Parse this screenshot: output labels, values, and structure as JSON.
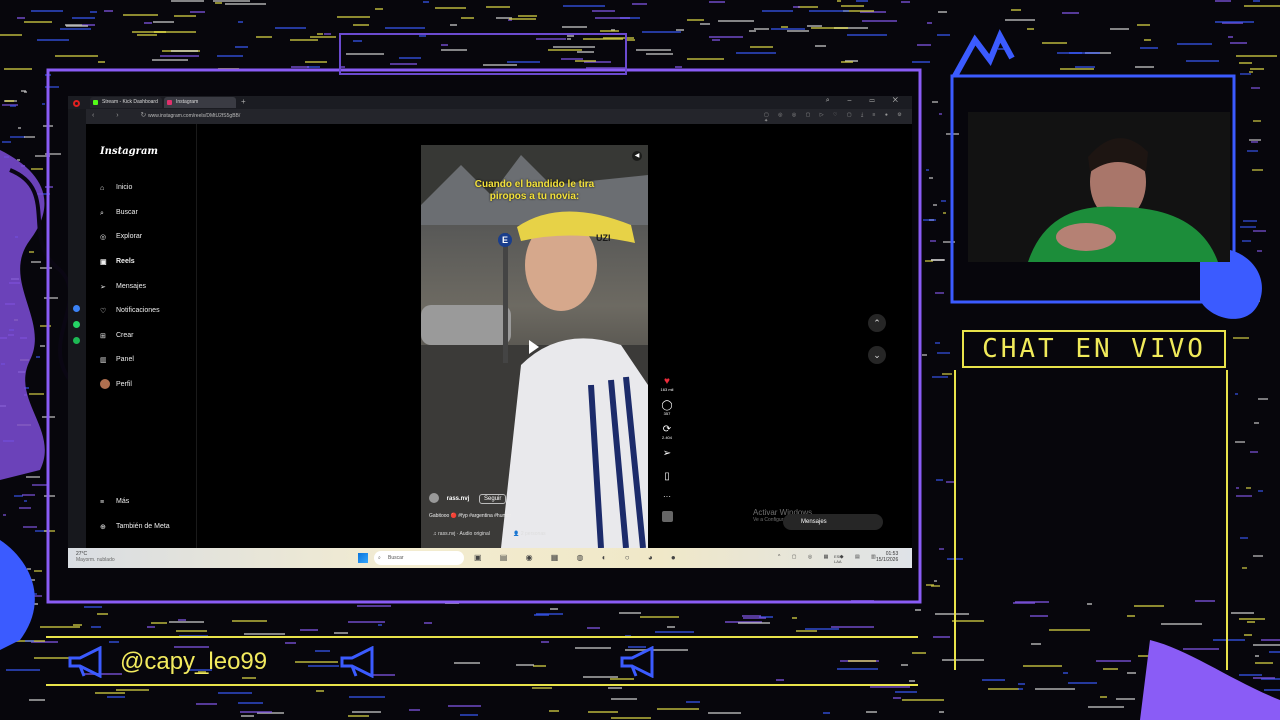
{
  "browser": {
    "tabs": [
      {
        "label": "Stream - Kick Dashboard",
        "color": "#53fc18"
      },
      {
        "label": "Instagram",
        "color": "#e1306c"
      }
    ],
    "url": "www.instagram.com/reels/DMtU2fS5gBB/"
  },
  "instagram": {
    "logo": "Instagram",
    "nav": [
      {
        "label": "Inicio",
        "icon": "home-icon"
      },
      {
        "label": "Buscar",
        "icon": "search-icon"
      },
      {
        "label": "Explorar",
        "icon": "compass-icon"
      },
      {
        "label": "Reels",
        "icon": "reels-icon"
      },
      {
        "label": "Mensajes",
        "icon": "send-icon"
      },
      {
        "label": "Notificaciones",
        "icon": "heart-icon"
      },
      {
        "label": "Crear",
        "icon": "plus-square-icon"
      },
      {
        "label": "Panel",
        "icon": "chart-icon"
      },
      {
        "label": "Perfil",
        "icon": "avatar-icon"
      }
    ],
    "more": "Más",
    "also_meta": "También de Meta",
    "reel": {
      "caption_line1": "Cuando el bandido le tira",
      "caption_line2": "piropos a tu novia:",
      "cap_text": "UZI",
      "sign_letter": "E",
      "author": "rass.nvj",
      "follow": "Seguir",
      "description": "Gabitooo 🔴 #fyp #argentina #humor",
      "audio": "rass.nvj · Audio original",
      "people": "2 personas",
      "likes": "163 mil",
      "comments": "357",
      "reposts": "2.404"
    },
    "messages_label": "Mensajes",
    "activate_windows": "Activar Windows",
    "activate_sub": "Ve a Configuración para activar Windows."
  },
  "taskbar": {
    "weather": "27°C",
    "weather_sub": "Mayorm. nublado",
    "search": "Buscar",
    "lang": "ESP LAA",
    "time": "01:53",
    "date": "15/1/2026"
  },
  "overlay": {
    "chat_title": "CHAT EN VIVO",
    "handle": "@capy_leo99"
  }
}
